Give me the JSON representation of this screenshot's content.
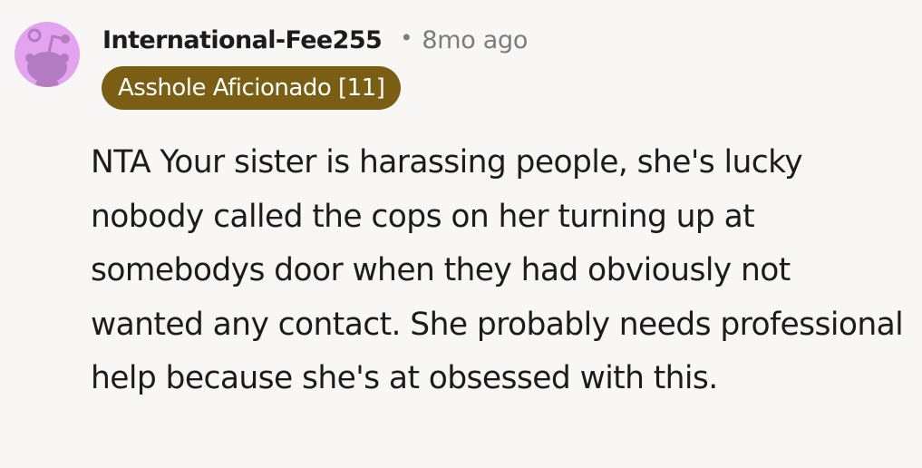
{
  "comment": {
    "author": "International-Fee255",
    "separator": "•",
    "timestamp": "8mo ago",
    "flair": "Asshole Aficionado [11]",
    "body": "NTA Your sister is harassing people, she's lucky nobody called the cops on her turning up at somebodys door when they had obviously not wanted any contact. She probably needs professional help because she's at obsessed with this.",
    "avatar_icon": "snoo-avatar-icon"
  },
  "colors": {
    "background": "#f9f7f6",
    "avatar_bg": "#e3a3ee",
    "avatar_figure": "#b27bc2",
    "flair_bg": "#7a5e14",
    "flair_text": "#ffffff",
    "username": "#1c1c1c",
    "meta": "#7c7c7c",
    "body_text": "#1c1c1c"
  }
}
